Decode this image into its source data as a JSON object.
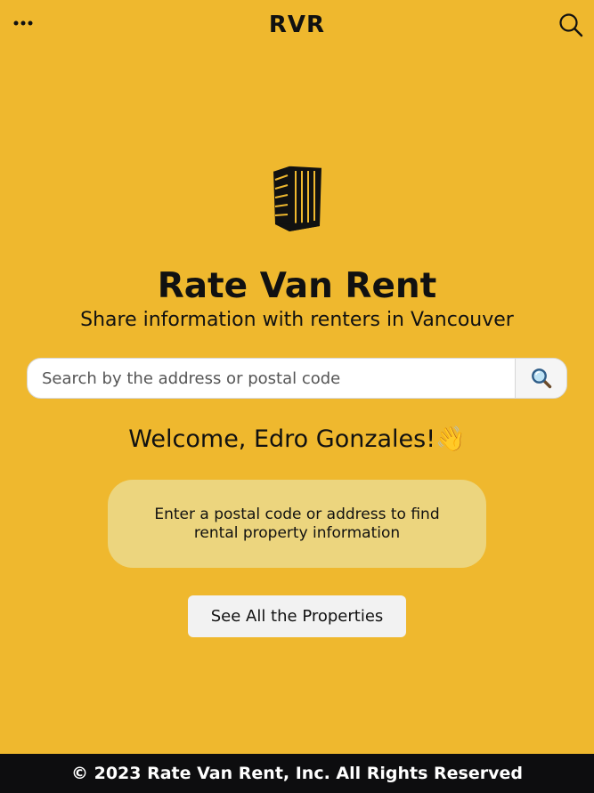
{
  "header": {
    "brand": "RVR",
    "menu_icon": "more-horizontal-icon",
    "search_icon": "search-icon"
  },
  "hero": {
    "icon": "building-icon",
    "title": "Rate Van Rent",
    "subtitle": "Share information with renters in Vancouver"
  },
  "search": {
    "placeholder": "Search by the address or postal code",
    "value": "",
    "button_icon": "magnifier-emoji-icon"
  },
  "welcome": {
    "text": "Welcome, Edro Gonzales!",
    "emoji": "👋"
  },
  "info_card": {
    "text": "Enter a postal code or address to find rental property information"
  },
  "actions": {
    "see_all_label": "See All the Properties"
  },
  "footer": {
    "text": "© 2023 Rate Van Rent, Inc. All Rights Reserved"
  },
  "colors": {
    "background": "#efb82e",
    "card": "#ecd57e",
    "footer": "#0d0d0f"
  }
}
